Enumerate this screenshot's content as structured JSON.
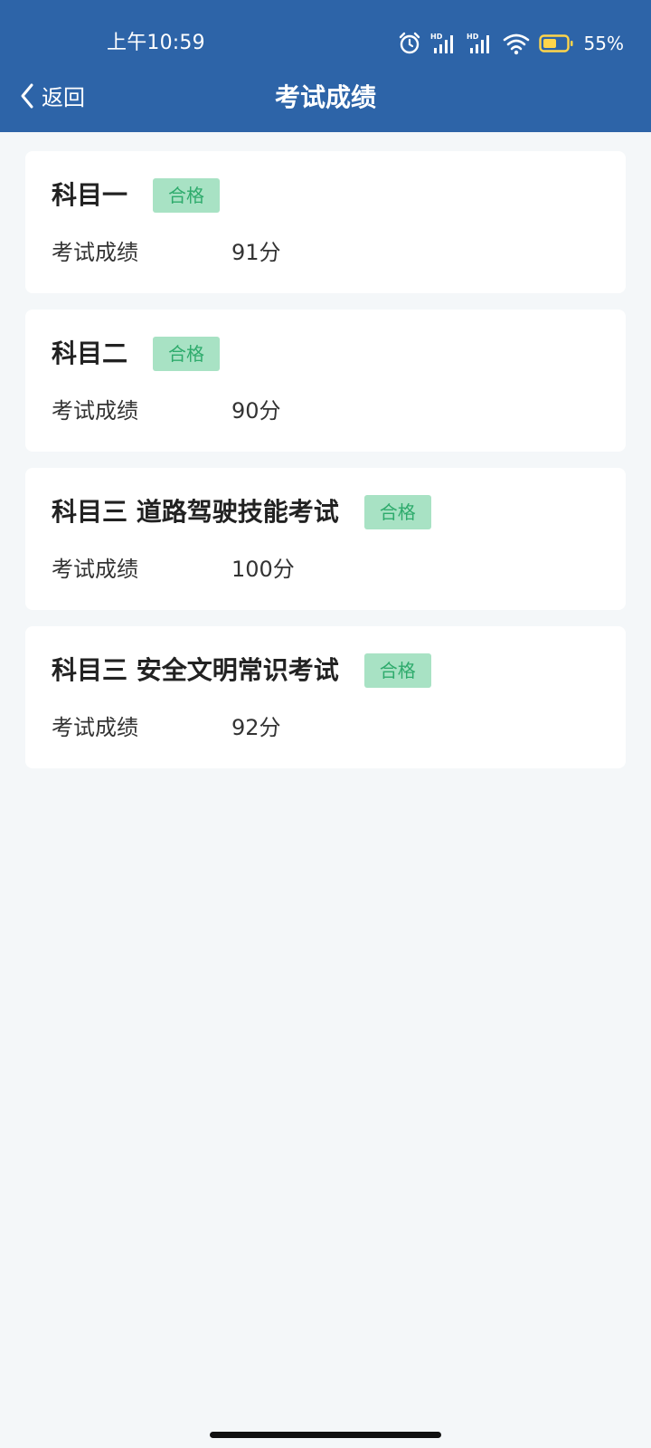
{
  "status_bar": {
    "time": "上午10:59",
    "battery_percent": "55%",
    "icons": [
      "alarm-icon",
      "hd-signal-icon",
      "hd-signal-icon",
      "wifi-icon",
      "battery-icon"
    ]
  },
  "header": {
    "back_label": "返回",
    "title": "考试成绩",
    "background_color": "#2d64a8"
  },
  "exams": [
    {
      "subject": "科目一",
      "status": "合格",
      "score_label": "考试成绩",
      "score": "91分"
    },
    {
      "subject": "科目二",
      "status": "合格",
      "score_label": "考试成绩",
      "score": "90分"
    },
    {
      "subject": "科目三 道路驾驶技能考试",
      "status": "合格",
      "score_label": "考试成绩",
      "score": "100分"
    },
    {
      "subject": "科目三 安全文明常识考试",
      "status": "合格",
      "score_label": "考试成绩",
      "score": "92分"
    }
  ],
  "colors": {
    "badge_background": "#a8e2c4",
    "badge_text": "#2eab6c",
    "page_background": "#f4f7f9"
  }
}
